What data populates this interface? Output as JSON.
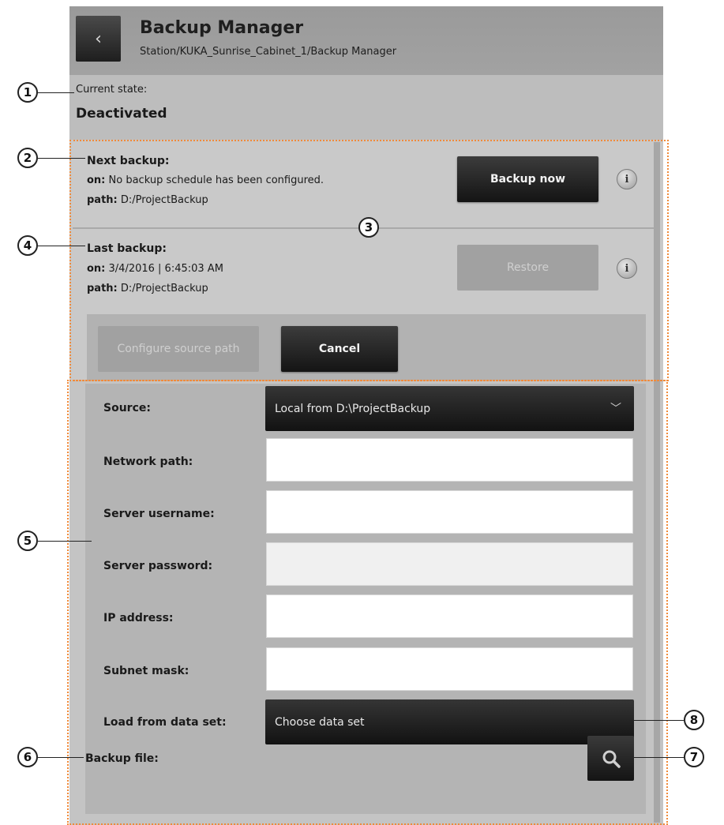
{
  "header": {
    "back_glyph": "‹",
    "title": "Backup Manager",
    "breadcrumb": "Station/KUKA_Sunrise_Cabinet_1/Backup Manager"
  },
  "state": {
    "label": "Current state:",
    "value": "Deactivated"
  },
  "next_backup": {
    "heading": "Next backup:",
    "on_key": "on:",
    "on_value": "No backup schedule has been configured.",
    "path_key": "path:",
    "path_value": "D:/ProjectBackup",
    "button": "Backup now"
  },
  "last_backup": {
    "heading": "Last backup:",
    "on_key": "on:",
    "on_value": "3/4/2016 | 6:45:03 AM",
    "path_key": "path:",
    "path_value": "D:/ProjectBackup",
    "button": "Restore"
  },
  "info_glyph": "i",
  "actions": {
    "configure": "Configure source path",
    "cancel": "Cancel"
  },
  "form": {
    "source_label": "Source:",
    "source_value": "Local from D:\\ProjectBackup",
    "network_label": "Network path:",
    "username_label": "Server username:",
    "password_label": "Server password:",
    "ip_label": "IP address:",
    "subnet_label": "Subnet mask:",
    "dataset_label": "Load from data set:",
    "dataset_value": "Choose data set",
    "backup_file_label": "Backup file:"
  },
  "callouts": [
    "1",
    "2",
    "3",
    "4",
    "5",
    "6",
    "7",
    "8"
  ],
  "colors": {
    "panel": "#c4c4c4",
    "dark_button": "#1e1e1e",
    "callout_border": "#f08a3a"
  }
}
